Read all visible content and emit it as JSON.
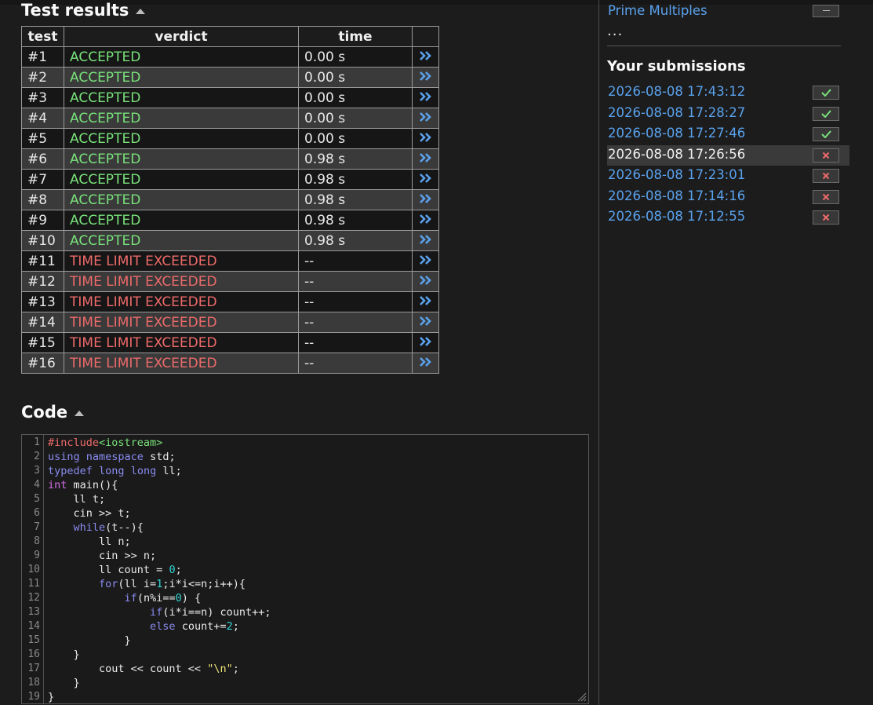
{
  "results": {
    "title": "Test results",
    "headers": {
      "test": "test",
      "verdict": "verdict",
      "time": "time"
    },
    "rows": [
      {
        "test": "#1",
        "verdict": "ACCEPTED",
        "time": "0.00 s"
      },
      {
        "test": "#2",
        "verdict": "ACCEPTED",
        "time": "0.00 s"
      },
      {
        "test": "#3",
        "verdict": "ACCEPTED",
        "time": "0.00 s"
      },
      {
        "test": "#4",
        "verdict": "ACCEPTED",
        "time": "0.00 s"
      },
      {
        "test": "#5",
        "verdict": "ACCEPTED",
        "time": "0.00 s"
      },
      {
        "test": "#6",
        "verdict": "ACCEPTED",
        "time": "0.98 s"
      },
      {
        "test": "#7",
        "verdict": "ACCEPTED",
        "time": "0.98 s"
      },
      {
        "test": "#8",
        "verdict": "ACCEPTED",
        "time": "0.98 s"
      },
      {
        "test": "#9",
        "verdict": "ACCEPTED",
        "time": "0.98 s"
      },
      {
        "test": "#10",
        "verdict": "ACCEPTED",
        "time": "0.98 s"
      },
      {
        "test": "#11",
        "verdict": "TIME LIMIT EXCEEDED",
        "time": "--"
      },
      {
        "test": "#12",
        "verdict": "TIME LIMIT EXCEEDED",
        "time": "--"
      },
      {
        "test": "#13",
        "verdict": "TIME LIMIT EXCEEDED",
        "time": "--"
      },
      {
        "test": "#14",
        "verdict": "TIME LIMIT EXCEEDED",
        "time": "--"
      },
      {
        "test": "#15",
        "verdict": "TIME LIMIT EXCEEDED",
        "time": "--"
      },
      {
        "test": "#16",
        "verdict": "TIME LIMIT EXCEEDED",
        "time": "--"
      }
    ]
  },
  "code": {
    "title": "Code",
    "lines": [
      [
        {
          "t": "#include",
          "k": "pp"
        },
        {
          "t": "<iostream>",
          "k": "inc"
        }
      ],
      [
        {
          "t": "using",
          "k": "kw"
        },
        {
          "t": " "
        },
        {
          "t": "namespace",
          "k": "kw"
        },
        {
          "t": " std;"
        }
      ],
      [
        {
          "t": "typedef",
          "k": "kw"
        },
        {
          "t": " "
        },
        {
          "t": "long",
          "k": "kw"
        },
        {
          "t": " "
        },
        {
          "t": "long",
          "k": "kw"
        },
        {
          "t": " ll;"
        }
      ],
      [
        {
          "t": "int",
          "k": "ty"
        },
        {
          "t": " main(){"
        }
      ],
      [
        {
          "t": "    ll t;"
        }
      ],
      [
        {
          "t": "    cin >> t;"
        }
      ],
      [
        {
          "t": "    "
        },
        {
          "t": "while",
          "k": "kw"
        },
        {
          "t": "(t--){"
        }
      ],
      [
        {
          "t": "        ll n;"
        }
      ],
      [
        {
          "t": "        cin >> n;"
        }
      ],
      [
        {
          "t": "        ll count = "
        },
        {
          "t": "0",
          "k": "num"
        },
        {
          "t": ";"
        }
      ],
      [
        {
          "t": "        "
        },
        {
          "t": "for",
          "k": "kw"
        },
        {
          "t": "(ll i="
        },
        {
          "t": "1",
          "k": "num"
        },
        {
          "t": ";i*i<=n;i++){"
        }
      ],
      [
        {
          "t": "            "
        },
        {
          "t": "if",
          "k": "kw"
        },
        {
          "t": "(n%i=="
        },
        {
          "t": "0",
          "k": "num"
        },
        {
          "t": ") {"
        }
      ],
      [
        {
          "t": "                "
        },
        {
          "t": "if",
          "k": "kw"
        },
        {
          "t": "(i*i==n) count++;"
        }
      ],
      [
        {
          "t": "                "
        },
        {
          "t": "else",
          "k": "kw"
        },
        {
          "t": " count+="
        },
        {
          "t": "2",
          "k": "num"
        },
        {
          "t": ";"
        }
      ],
      [
        {
          "t": "            }"
        }
      ],
      [
        {
          "t": "    }"
        }
      ],
      [
        {
          "t": "        cout << count << "
        },
        {
          "t": "\"\\n\"",
          "k": "str"
        },
        {
          "t": ";"
        }
      ],
      [
        {
          "t": "    }"
        }
      ],
      [
        {
          "t": "}"
        }
      ]
    ]
  },
  "sidebar": {
    "task_link": "Prime Multiples",
    "ellipsis": "...",
    "submissions_title": "Your submissions",
    "submissions": [
      {
        "date": "2026-08-08 17:43:12",
        "status": "accepted"
      },
      {
        "date": "2026-08-08 17:28:27",
        "status": "accepted"
      },
      {
        "date": "2026-08-08 17:27:46",
        "status": "accepted"
      },
      {
        "date": "2026-08-08 17:26:56",
        "status": "rejected",
        "selected": true
      },
      {
        "date": "2026-08-08 17:23:01",
        "status": "rejected"
      },
      {
        "date": "2026-08-08 17:14:16",
        "status": "rejected"
      },
      {
        "date": "2026-08-08 17:12:55",
        "status": "rejected"
      }
    ]
  },
  "icons": {
    "details": "double-chevron-right-icon",
    "collapse": "triangle-up-icon",
    "accepted": "check-icon",
    "rejected": "cross-icon"
  },
  "colors": {
    "accepted": "#78e27a",
    "rejected": "#ee6a6a",
    "link": "#5aa2ee",
    "background": "#1c1c1c",
    "row_alt": "#3a3a3a",
    "syntax": {
      "pp": "#ee6a6a",
      "inc": "#78e27a",
      "kw": "#8a8cf0",
      "ty": "#d36ee6",
      "num": "#33d4d4",
      "str": "#f2e57a"
    }
  }
}
